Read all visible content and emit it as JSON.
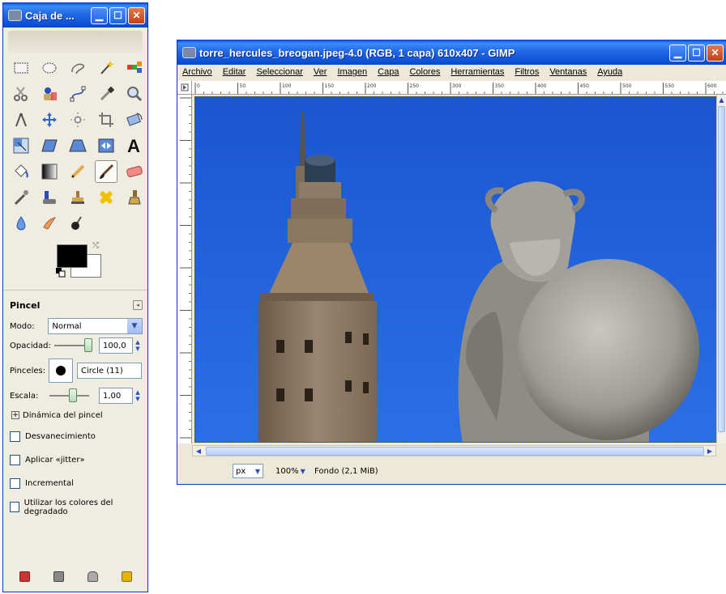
{
  "toolbox": {
    "title": "Caja de ...",
    "tools": [
      "rect-select-icon",
      "ellipse-select-icon",
      "free-select-icon",
      "fuzzy-select-icon",
      "color-select-icon",
      "scissors-icon",
      "foreground-select-icon",
      "paths-icon",
      "color-picker-icon",
      "zoom-icon",
      "measure-icon",
      "move-icon",
      "align-icon",
      "crop-icon",
      "rotate-icon",
      "scale-icon",
      "shear-icon",
      "perspective-icon",
      "flip-icon",
      "text-icon",
      "bucket-fill-icon",
      "blend-icon",
      "pencil-icon",
      "paintbrush-icon",
      "eraser-icon",
      "airbrush-icon",
      "ink-icon",
      "clone-icon",
      "heal-icon",
      "perspective-clone-icon",
      "blur-icon",
      "smudge-icon",
      "dodge-burn-icon"
    ],
    "options": {
      "tool_name": "Pincel",
      "mode_label": "Modo:",
      "mode_value": "Normal",
      "opacity_label": "Opacidad:",
      "opacity_value": "100,0",
      "brushes_label": "Pinceles:",
      "brush_name": "Circle (11)",
      "scale_label": "Escala:",
      "scale_value": "1,00",
      "dynamics_label": "Dinámica del pincel",
      "checkboxes": [
        "Desvanecimiento",
        "Aplicar «jitter»",
        "Incremental",
        "Utilizar los colores del degradado"
      ]
    },
    "colors": {
      "foreground": "#000000",
      "background": "#ffffff"
    }
  },
  "image_window": {
    "title": "torre_hercules_breogan.jpeg-4.0 (RGB, 1 capa) 610x407 - GIMP",
    "menu": [
      "Archivo",
      "Editar",
      "Seleccionar",
      "Ver",
      "Imagen",
      "Capa",
      "Colores",
      "Herramientas",
      "Filtros",
      "Ventanas",
      "Ayuda"
    ],
    "ruler_marks": [
      "0",
      "50",
      "100",
      "150",
      "200",
      "250",
      "300",
      "350",
      "400",
      "450",
      "500",
      "550",
      "600"
    ],
    "status": {
      "unit": "px",
      "zoom": "100%",
      "layer_info": "Fondo (2,1 MiB)"
    }
  }
}
